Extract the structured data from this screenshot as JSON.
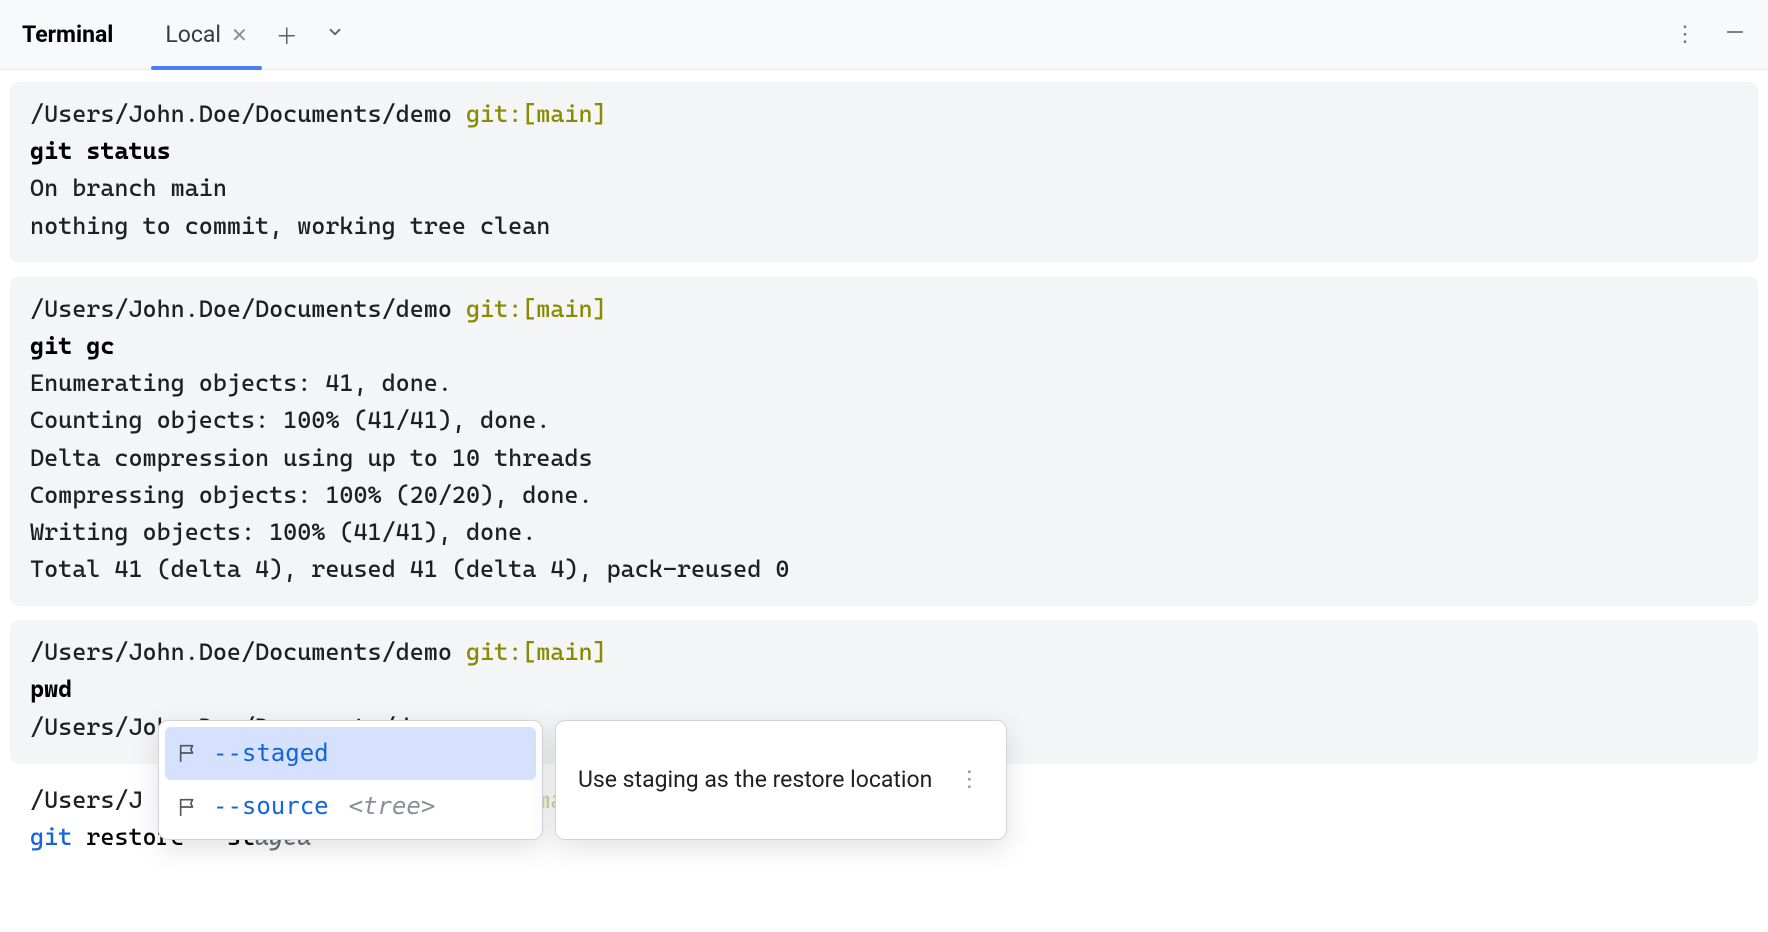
{
  "tabs": {
    "title": "Terminal",
    "active": {
      "label": "Local"
    }
  },
  "colors": {
    "accent": "#4a7dfc",
    "git_prompt": "#8a8a00",
    "cmd_blue": "#1565d8",
    "ghost": "#6b6f78",
    "block_bg": "#f4f5f7"
  },
  "prompt": {
    "path": "/Users/John.Doe/Documents/demo",
    "git": "git:[main]"
  },
  "blocks": [
    {
      "command": "git status",
      "output": "On branch main\nnothing to commit, working tree clean"
    },
    {
      "command": "git gc",
      "output": "Enumerating objects: 41, done.\nCounting objects: 100% (41/41), done.\nDelta compression using up to 10 threads\nCompressing objects: 100% (20/20), done.\nWriting objects: 100% (41/41), done.\nTotal 41 (delta 4), reused 41 (delta 4), pack-reused 0"
    },
    {
      "command": "pwd",
      "output": "/Users/John.Doe/Documents/demo"
    }
  ],
  "current": {
    "prompt_path_trunc": "/Users/J",
    "prompt_git_trunc": "t:[main]",
    "tok_git": "git",
    "tok_sub": "restore",
    "tok_flag_typed": "--st",
    "tok_flag_ghost": "aged"
  },
  "autocomplete": {
    "items": [
      {
        "flag": "--staged",
        "arg": ""
      },
      {
        "flag": "--source",
        "arg": "<tree>"
      }
    ],
    "tip": "Use staging as the restore location"
  }
}
